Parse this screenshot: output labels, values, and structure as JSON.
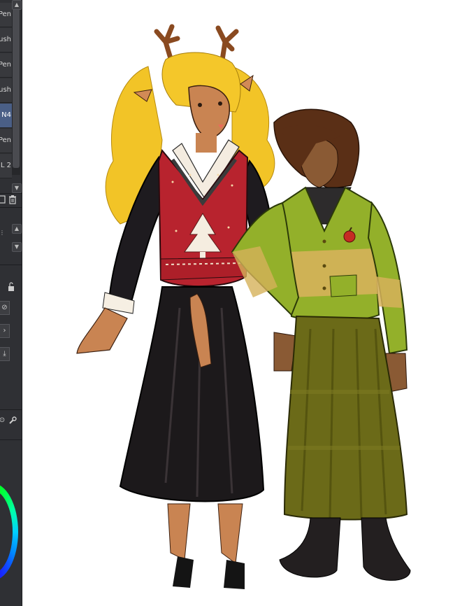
{
  "layers_panel": {
    "items": [
      {
        "label": "Pen"
      },
      {
        "label": "Brush"
      },
      {
        "label": "Pen"
      },
      {
        "label": "Brush"
      },
      {
        "label": "N4"
      },
      {
        "label": "Pen"
      },
      {
        "label": "L 2"
      }
    ],
    "selected_index": 4
  },
  "colors": {
    "panel_bg": "#2f3034",
    "selection": "#4a5f86",
    "canvas_bg": "#ffffff"
  },
  "icons": [
    "chevron-up-icon",
    "chevron-down-icon",
    "new-layer-icon",
    "trash-icon",
    "lock-icon",
    "mask-icon",
    "arrow-right-icon",
    "download-icon",
    "settings-icon",
    "wrench-icon"
  ]
}
